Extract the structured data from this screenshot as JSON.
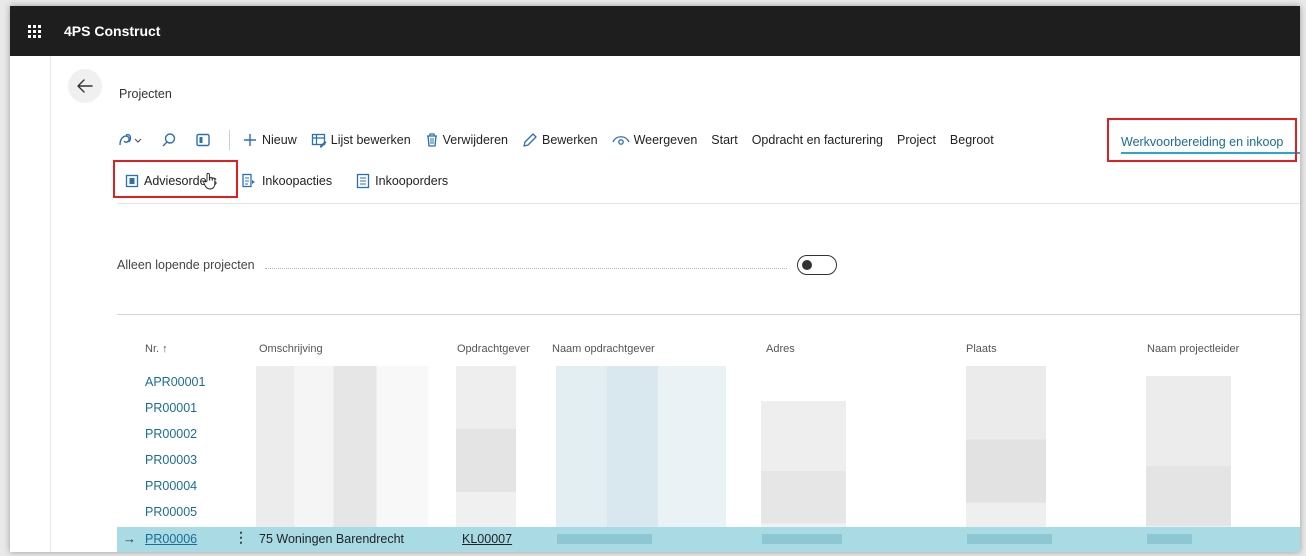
{
  "app": {
    "title": "4PS Construct"
  },
  "page": {
    "title": "Projecten"
  },
  "actions": {
    "new": "Nieuw",
    "edit_list": "Lijst bewerken",
    "delete": "Verwijderen",
    "edit": "Bewerken",
    "view": "Weergeven",
    "start": "Start",
    "orders_invoicing": "Opdracht en facturering",
    "project": "Project",
    "budget": "Begroot",
    "work_prep": "Werkvoorbereiding en inkoop"
  },
  "sub_actions": {
    "advice_orders": "Adviesorders",
    "purchase_actions": "Inkoopacties",
    "purchase_orders": "Inkooporders"
  },
  "filter": {
    "label": "Alleen lopende projecten",
    "value": false
  },
  "columns": {
    "nr": "Nr. ↑",
    "description": "Omschrijving",
    "customer": "Opdrachtgever",
    "customer_name": "Naam opdrachtgever",
    "address": "Adres",
    "city": "Plaats",
    "project_leader": "Naam projectleider"
  },
  "rows": [
    {
      "nr": "APR00001"
    },
    {
      "nr": "PR00001"
    },
    {
      "nr": "PR00002"
    },
    {
      "nr": "PR00003"
    },
    {
      "nr": "PR00004"
    },
    {
      "nr": "PR00005"
    }
  ],
  "selected_row": {
    "arrow": "→",
    "nr": "PR00006",
    "menu": "⋮",
    "description": "75 Woningen Barendrecht",
    "customer": "KL00007"
  },
  "colors": {
    "topbar": "#1e1e1e",
    "link": "#1a6e93",
    "accent": "#27a9c6",
    "highlight": "#e02020",
    "selected_row": "#a9dbe5"
  },
  "icons": [
    "app-launcher-icon",
    "back-arrow-icon",
    "copilot-icon",
    "search-icon",
    "layout-icon",
    "plus-icon",
    "edit-list-icon",
    "trash-icon",
    "pencil-icon",
    "eye-icon",
    "advice-orders-icon",
    "purchase-actions-icon",
    "purchase-orders-icon",
    "hand-pointer-icon"
  ]
}
